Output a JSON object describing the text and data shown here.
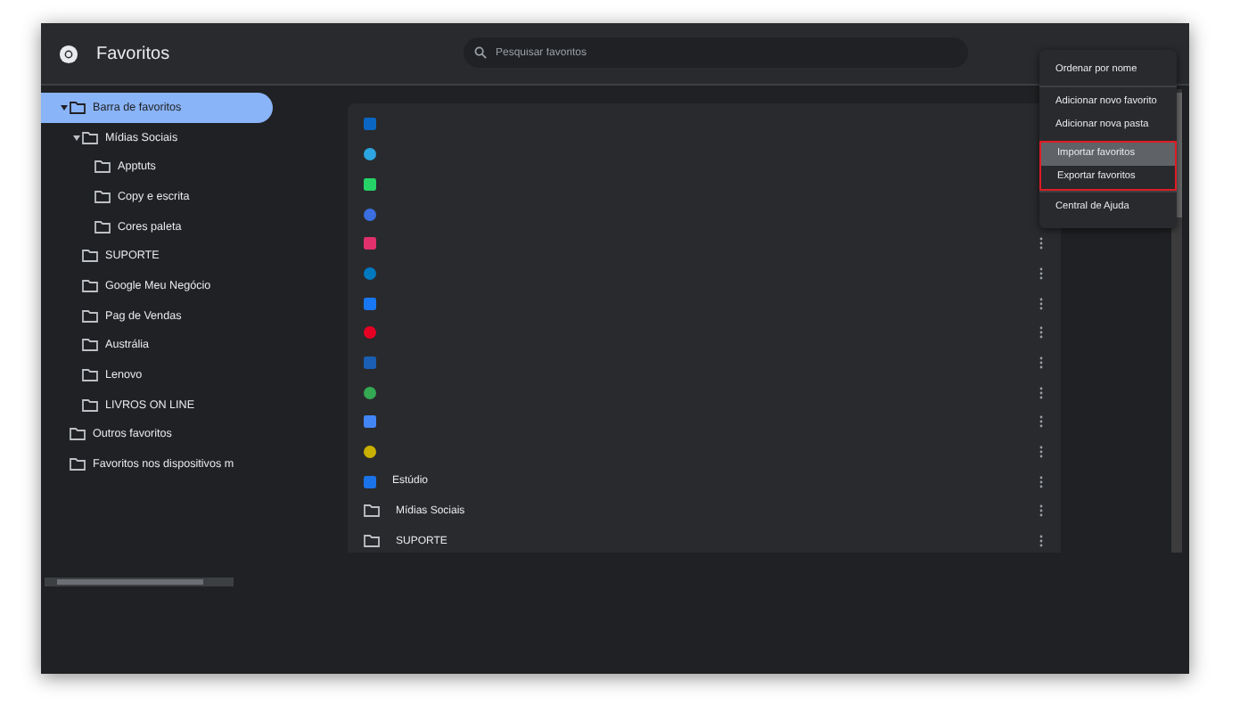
{
  "header": {
    "title": "Favoritos",
    "search": {
      "placeholder": "Pesquisar favoritos"
    }
  },
  "tree": [
    {
      "label": "Barra de favoritos",
      "selected": true,
      "expanded": true,
      "children": [
        {
          "label": "Mídias Sociais",
          "selected": false,
          "expanded": true,
          "children": [
            {
              "label": "Apptuts",
              "selected": false
            },
            {
              "label": "Copy e escrita",
              "selected": false
            },
            {
              "label": "Cores paleta",
              "selected": false
            }
          ]
        },
        {
          "label": "SUPORTE",
          "selected": false
        },
        {
          "label": "Google Meu Negócio",
          "selected": false
        },
        {
          "label": "Pag de Vendas",
          "selected": false
        },
        {
          "label": "Austrália",
          "selected": false
        },
        {
          "label": "Lenovo",
          "selected": false
        },
        {
          "label": "LIVROS ON LINE",
          "selected": false
        }
      ]
    },
    {
      "label": "Outros favoritos",
      "selected": false
    },
    {
      "label": "Favoritos nos dispositivos m",
      "selected": false
    }
  ],
  "list": [
    {
      "kind": "link",
      "color": "#0a66c2"
    },
    {
      "kind": "link",
      "color": "#2ca5e0"
    },
    {
      "kind": "link",
      "color": "#25d366"
    },
    {
      "kind": "link",
      "color": "#3b6fe0"
    },
    {
      "kind": "link",
      "color": "#e1306c"
    },
    {
      "kind": "link",
      "color": "#0079bf"
    },
    {
      "kind": "link",
      "color": "#1877f2"
    },
    {
      "kind": "link",
      "color": "#e60023"
    },
    {
      "kind": "link",
      "color": "#1a5fb4"
    },
    {
      "kind": "link",
      "color": "#34a853"
    },
    {
      "kind": "link",
      "color": "#4285f4"
    },
    {
      "kind": "link",
      "color": "#c9b000"
    },
    {
      "kind": "link",
      "color": "#1a73e8",
      "title": "Estúdio"
    },
    {
      "kind": "folder",
      "title": "Mídias Sociais"
    },
    {
      "kind": "folder",
      "title": "SUPORTE"
    }
  ],
  "menu": {
    "sections": [
      {
        "items": [
          {
            "label": "Ordenar por nome",
            "selected": false
          }
        ]
      },
      {
        "items": [
          {
            "label": "Adicionar novo favorito",
            "selected": false
          },
          {
            "label": "Adicionar nova pasta",
            "selected": false
          }
        ]
      },
      {
        "annotated": true,
        "items": [
          {
            "label": "Importar favoritos",
            "selected": true
          },
          {
            "label": "Exportar favoritos",
            "selected": false
          }
        ]
      },
      {
        "items": [
          {
            "label": "Central de Ajuda",
            "selected": false
          }
        ]
      }
    ]
  }
}
